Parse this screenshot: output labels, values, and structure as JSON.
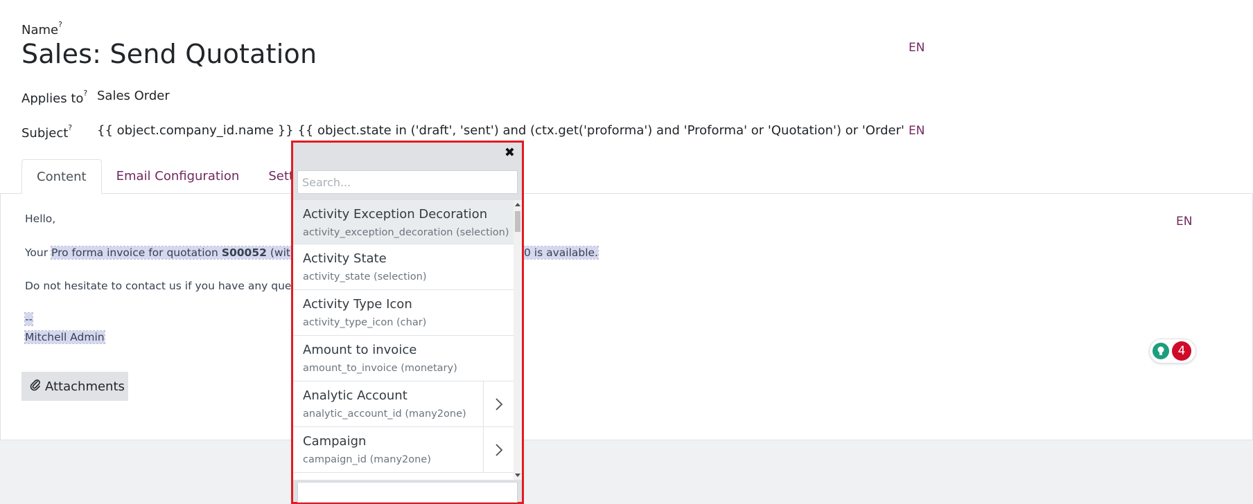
{
  "form": {
    "name_label": "Name",
    "help_mark": "?",
    "name_value": "Sales: Send Quotation",
    "lang": "EN",
    "applies_label": "Applies to",
    "applies_value": "Sales Order",
    "subject_label": "Subject",
    "subject_value": "{{ object.company_id.name }} {{ object.state in ('draft', 'sent') and (ctx.get('proforma') and 'Proforma' or 'Quotation') or 'Order' }} (Ref {{ object.name or 'n/a' }})"
  },
  "tabs": [
    {
      "label": "Content"
    },
    {
      "label": "Email Configuration"
    },
    {
      "label": "Settings"
    }
  ],
  "body": {
    "hello": "Hello,",
    "your": "Your",
    "line2_a": "Pro forma invoice for",
    "line2_b": "quotation",
    "line2_c": "S00052",
    "line2_d": "(with ref",
    "line2_e": "0 is available.",
    "line3": "Do not hesitate to contact us if you have any question",
    "sig_dash": "--",
    "sig_name": "Mitchell Admin",
    "attachments_label": "Attachments",
    "notification_count": "4"
  },
  "popover": {
    "search_placeholder": "Search...",
    "items": [
      {
        "title": "Activity Exception Decoration",
        "subtitle": "activity_exception_decoration (selection)"
      },
      {
        "title": "Activity State",
        "subtitle": "activity_state (selection)"
      },
      {
        "title": "Activity Type Icon",
        "subtitle": "activity_type_icon (char)"
      },
      {
        "title": "Amount to invoice",
        "subtitle": "amount_to_invoice (monetary)"
      },
      {
        "title": "Analytic Account",
        "subtitle": "analytic_account_id (many2one)"
      },
      {
        "title": "Campaign",
        "subtitle": "campaign_id (many2one)"
      }
    ]
  },
  "colors": {
    "link": "#71285f",
    "highlight": "#d5d8ef",
    "popover_border": "#e11b22",
    "badge_red": "#d00a2a",
    "bulb_green": "#1b9e7e"
  }
}
